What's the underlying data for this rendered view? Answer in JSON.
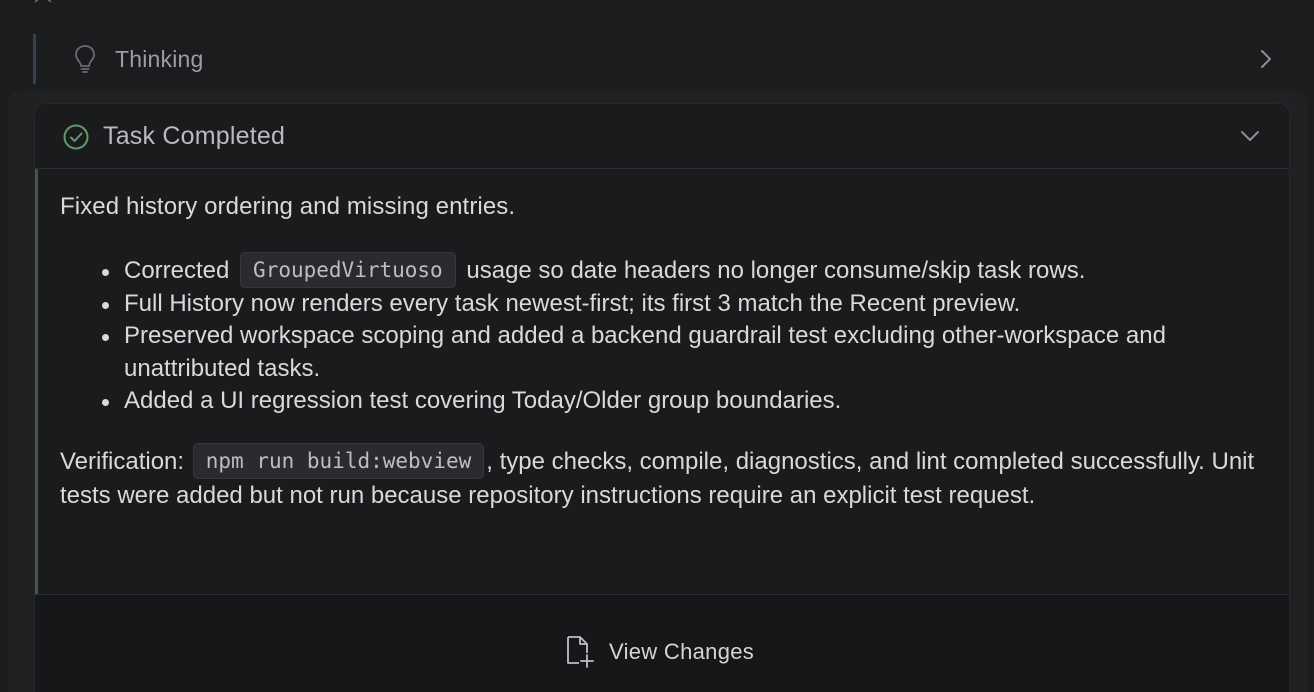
{
  "thinking": {
    "label": "Thinking"
  },
  "task": {
    "title": "Task Completed",
    "summary": "Fixed history ordering and missing entries.",
    "bullets": [
      {
        "before": "Corrected",
        "code": "GroupedVirtuoso",
        "after": "usage so date headers no longer consume/skip task rows."
      },
      {
        "text": "Full History now renders every task newest-first; its first 3 match the Recent preview."
      },
      {
        "text": "Preserved workspace scoping and added a backend guardrail test excluding other-workspace and unattributed tasks."
      },
      {
        "text": "Added a UI regression test covering Today/Older group boundaries."
      }
    ],
    "verification": {
      "label": "Verification:",
      "code": "npm run build:webview",
      "text": ", type checks, compile, diagnostics, and lint completed successfully. Unit tests were added but not run because repository instructions require an explicit test request."
    },
    "view_changes_label": "View Changes"
  },
  "icons": {
    "top": "star-icon",
    "thinking": "lightbulb-icon",
    "thinking_toggle": "chevron-right-icon",
    "status": "check-circle-icon",
    "collapse": "chevron-down-icon",
    "view_changes": "file-plus-icon"
  },
  "colors": {
    "background": "#1b1c1e",
    "success_green": "#5d9a6a",
    "thinking_accent": "#34414f"
  }
}
